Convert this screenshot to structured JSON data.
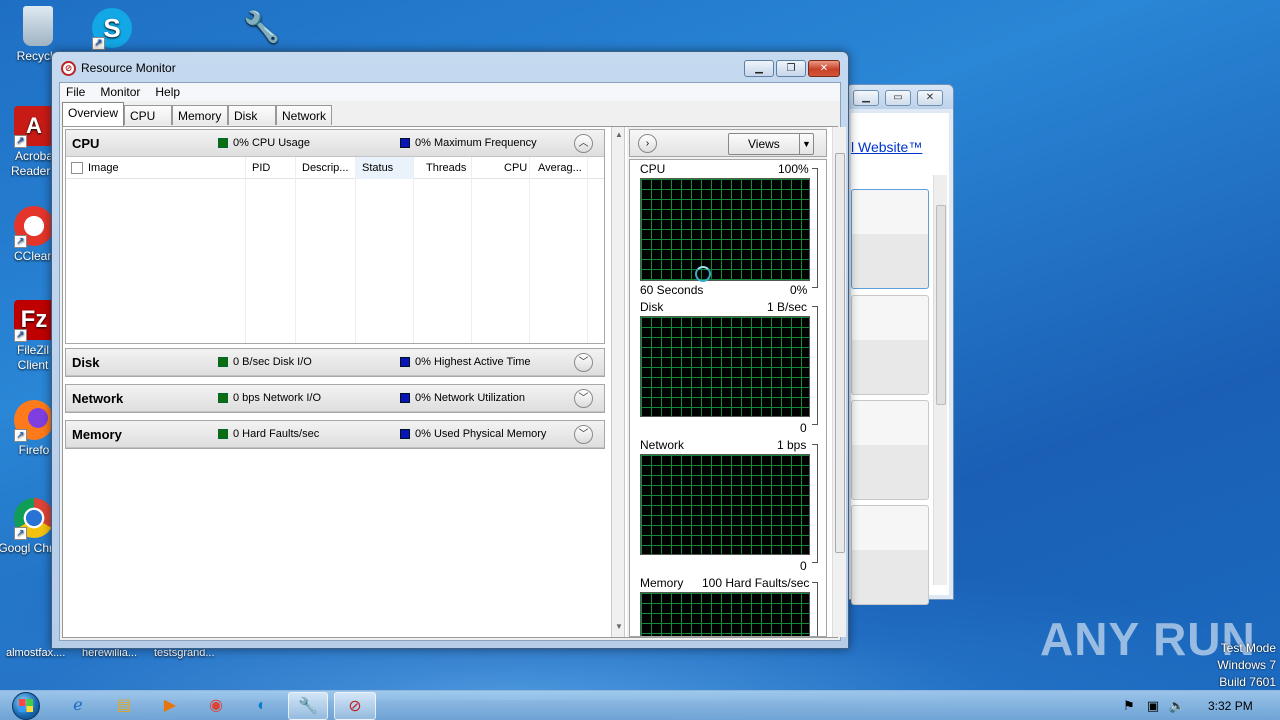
{
  "desktop": {
    "icons": [
      {
        "label": "Recycle",
        "name": "recycle-bin"
      },
      {
        "label": "Acroba Reader I",
        "name": "acrobat-reader"
      },
      {
        "label": "CClean",
        "name": "ccleaner"
      },
      {
        "label": "FileZil Client",
        "name": "filezilla"
      },
      {
        "label": "Firefo",
        "name": "firefox"
      },
      {
        "label": "Googl Chrom",
        "name": "chrome"
      }
    ],
    "bottom_labels": [
      "almostfax....",
      "herewillia...",
      "testsgrand..."
    ],
    "watermark": {
      "line1": "Test Mode",
      "line2": "Windows 7",
      "line3": "Build 7601"
    },
    "brand": "ANY RUN"
  },
  "background_window": {
    "link_text": "l Website™"
  },
  "window": {
    "title": "Resource Monitor",
    "menu": [
      "File",
      "Monitor",
      "Help"
    ],
    "tabs": [
      "Overview",
      "CPU",
      "Memory",
      "Disk",
      "Network"
    ],
    "active_tab": "Overview"
  },
  "sections": {
    "cpu": {
      "title": "CPU",
      "ind1": "0% CPU Usage",
      "ind2": "0% Maximum Frequency",
      "columns": [
        "Image",
        "PID",
        "Descrip...",
        "Status",
        "Threads",
        "CPU",
        "Averag..."
      ]
    },
    "disk": {
      "title": "Disk",
      "ind1": "0 B/sec Disk I/O",
      "ind2": "0% Highest Active Time"
    },
    "network": {
      "title": "Network",
      "ind1": "0 bps Network I/O",
      "ind2": "0% Network Utilization"
    },
    "memory": {
      "title": "Memory",
      "ind1": "0 Hard Faults/sec",
      "ind2": "0% Used Physical Memory"
    }
  },
  "right_pane": {
    "views_label": "Views",
    "graphs": {
      "cpu": {
        "label": "CPU",
        "max": "100%",
        "footer_left": "60 Seconds",
        "footer_right": "0%"
      },
      "disk": {
        "label": "Disk",
        "max": "1 B/sec",
        "footer_right": "0"
      },
      "network": {
        "label": "Network",
        "max": "1 bps",
        "footer_right": "0"
      },
      "memory": {
        "label": "Memory",
        "max": "100 Hard Faults/sec"
      }
    }
  },
  "taskbar": {
    "clock": "3:32 PM"
  }
}
